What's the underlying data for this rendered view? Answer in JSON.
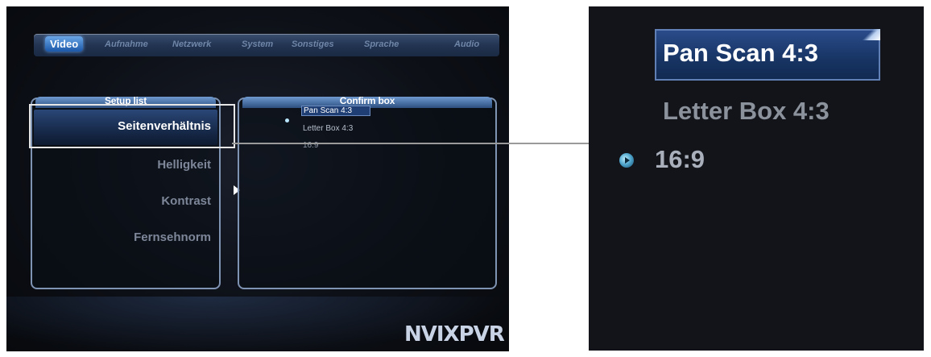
{
  "tabs": [
    {
      "label": "Video",
      "active": true
    },
    {
      "label": "Aufnahme"
    },
    {
      "label": "Netzwerk"
    },
    {
      "label": "System"
    },
    {
      "label": "Sonstiges"
    },
    {
      "label": "Sprache"
    },
    {
      "label": "Audio"
    }
  ],
  "setup_list": {
    "title": "Setup list",
    "items": [
      "Seitenverhältnis",
      "Helligkeit",
      "Kontrast",
      "Fernsehnorm"
    ],
    "selected_index": 0
  },
  "confirm_box": {
    "title": "Confirm box",
    "options": [
      "Pan Scan 4:3",
      "Letter Box 4:3",
      "16:9"
    ],
    "highlighted_index": 0,
    "current_index": 2
  },
  "logo": "NVIXPVR",
  "zoom": {
    "options": [
      "Pan Scan 4:3",
      "Letter Box 4:3",
      "16:9"
    ]
  },
  "colors": {
    "accent_blue": "#1f3e74",
    "panel_border": "#7f93b3",
    "background": "#0d1017"
  }
}
